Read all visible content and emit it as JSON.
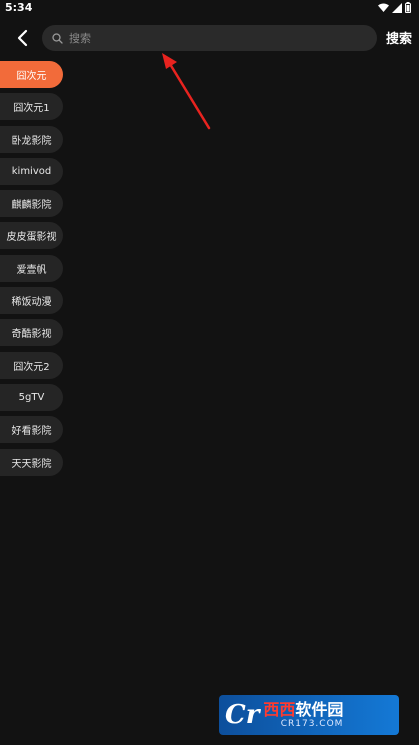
{
  "status_bar": {
    "time": "5:34"
  },
  "header": {
    "search_placeholder": "搜索",
    "search_button_label": "搜索"
  },
  "sources": [
    {
      "label": "囧次元",
      "active": true
    },
    {
      "label": "囧次元1",
      "active": false
    },
    {
      "label": "卧龙影院",
      "active": false
    },
    {
      "label": "kimivod",
      "active": false
    },
    {
      "label": "麒麟影院",
      "active": false
    },
    {
      "label": "皮皮蛋影视",
      "active": false
    },
    {
      "label": "爱壹帆",
      "active": false
    },
    {
      "label": "稀饭动漫",
      "active": false
    },
    {
      "label": "奇酷影视",
      "active": false
    },
    {
      "label": "囧次元2",
      "active": false
    },
    {
      "label": "5gTV",
      "active": false
    },
    {
      "label": "好看影院",
      "active": false
    },
    {
      "label": "天天影院",
      "active": false
    }
  ],
  "colors": {
    "background": "#121212",
    "accent": "#f26b3a",
    "chip": "#252525",
    "search_box": "#2a2a2a",
    "annotation": "#e8231f"
  },
  "icons": {
    "back": "chevron-left-icon",
    "search": "magnifier-icon",
    "wifi": "wifi-icon",
    "signal": "signal-icon",
    "battery": "battery-icon"
  },
  "watermark": {
    "logo": "Cr",
    "title_part1": "西西",
    "title_part2": "软件园",
    "domain": "CR173.COM"
  }
}
